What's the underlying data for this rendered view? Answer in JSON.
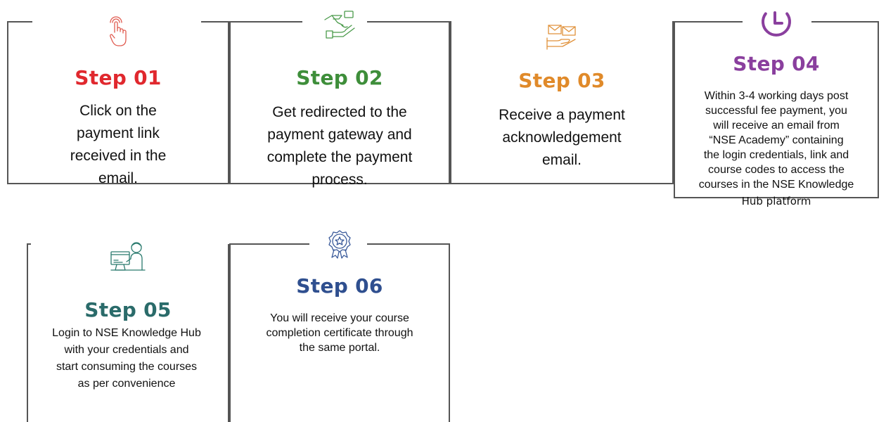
{
  "steps": [
    {
      "title": "Step 01",
      "color": "#e0282e",
      "icon": "tap-finger-icon",
      "lines": [
        "Click on the",
        "payment link",
        "received in the",
        "email."
      ]
    },
    {
      "title": "Step 02",
      "color": "#3e8e3a",
      "icon": "hand-money-exchange-icon",
      "lines": [
        "Get redirected to the",
        "payment gateway and",
        "complete the payment",
        "process."
      ]
    },
    {
      "title": "Step 03",
      "color": "#e08a2a",
      "icon": "hand-envelope-icon",
      "lines": [
        "Receive a payment",
        "acknowledgement",
        "email."
      ]
    },
    {
      "title": "Step 04",
      "color": "#8a3f9e",
      "icon": "clock-icon",
      "lines": [
        "Within 3-4 working days post",
        "successful fee payment, you",
        "will receive an email from",
        "“NSE Academy” containing",
        "the login credentials, link and",
        "course codes to access the",
        "courses in the NSE Knowledge",
        "Hub platform"
      ]
    },
    {
      "title": "Step 05",
      "color": "#2a6b6a",
      "icon": "person-computer-icon",
      "lines": [
        "Login to NSE Knowledge Hub",
        "with your credentials and",
        "start consuming the courses",
        "as per convenience"
      ]
    },
    {
      "title": "Step 06",
      "color": "#2f4f8f",
      "icon": "award-badge-icon",
      "lines": [
        "You will receive your course",
        "completion certificate through",
        "the same portal."
      ]
    }
  ]
}
